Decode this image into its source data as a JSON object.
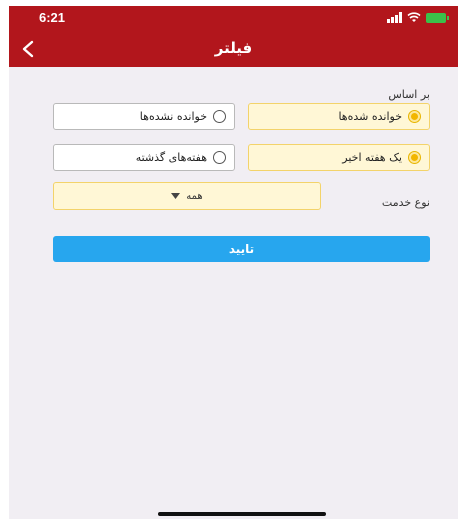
{
  "status_bar": {
    "time": "6:21",
    "icons": [
      "signal-icon",
      "wifi-icon",
      "battery-charging-icon"
    ]
  },
  "header": {
    "title": "فیلتر",
    "back_icon": "chevron-left-icon"
  },
  "filter": {
    "based_on_label": "بر اساس",
    "options": [
      {
        "label": "خوانده شده‌ها",
        "selected": true
      },
      {
        "label": "خوانده نشده‌ها",
        "selected": false
      },
      {
        "label": "یک هفته اخیر",
        "selected": true
      },
      {
        "label": "هفته‌های گذشته",
        "selected": false
      }
    ],
    "service_type_label": "نوع خدمت",
    "service_type_value": "همه",
    "confirm_label": "تایید"
  },
  "colors": {
    "header_bg": "#b2161c",
    "selected_bg": "#fff7d6",
    "selected_border": "#f3d36a",
    "button_bg": "#27a6ee"
  }
}
